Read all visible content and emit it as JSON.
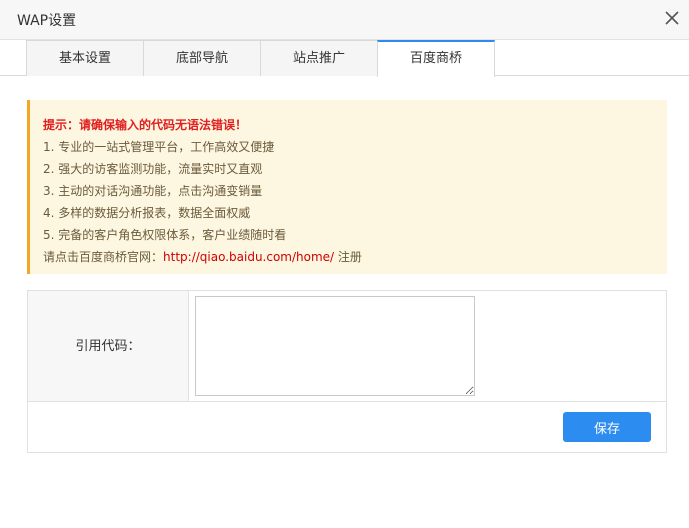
{
  "window": {
    "title": "WAP设置"
  },
  "tabs": [
    {
      "label": "基本设置",
      "active": false
    },
    {
      "label": "底部导航",
      "active": false
    },
    {
      "label": "站点推广",
      "active": false
    },
    {
      "label": "百度商桥",
      "active": true
    }
  ],
  "tip": {
    "warning": "提示：请确保输入的代码无语法错误！",
    "items": [
      "1. 专业的一站式管理平台，工作高效又便捷",
      "2. 强大的访客监测功能，流量实时又直观",
      "3. 主动的对话沟通功能，点击沟通变销量",
      "4. 多样的数据分析报表，数据全面权威",
      "5. 完备的客户角色权限体系，客户业绩随时看"
    ],
    "visit_prefix": "请点击百度商桥官网：",
    "visit_link": "http://qiao.baidu.com/home/",
    "register": " 注册"
  },
  "form": {
    "code_label": "引用代码：",
    "code_value": "",
    "save_label": "保存"
  },
  "colors": {
    "accent": "#2d8cf0",
    "warning_text": "#e02020",
    "tip_background": "#fdf7e1",
    "tip_border": "#f5a623"
  }
}
